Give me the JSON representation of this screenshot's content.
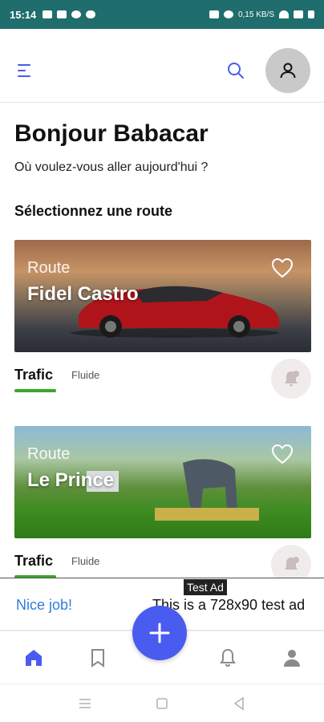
{
  "status_bar": {
    "time": "15:14",
    "right_text": "0,15 KB/S",
    "background": "#1f6d6d"
  },
  "app_bar": {
    "menu_icon": "menu-icon",
    "search_icon": "search-icon",
    "avatar_icon": "user-icon"
  },
  "greeting": {
    "title": "Bonjour Babacar",
    "subtitle": "Où voulez-vous aller aujourd'hui ?"
  },
  "section": {
    "title": "Sélectionnez une route"
  },
  "routes": [
    {
      "label": "Route",
      "name": "Fidel Castro",
      "traffic_label": "Trafic",
      "traffic_status": "Fluide",
      "traffic_color": "#3ca52a"
    },
    {
      "label": "Route",
      "name": "Le Prince",
      "traffic_label": "Trafic",
      "traffic_status": "Fluide",
      "traffic_color": "#3ca52a"
    }
  ],
  "ad": {
    "badge": "Test Ad",
    "nice": "Nice job!",
    "text": "This is a 728x90 test ad"
  },
  "bottom_nav": {
    "items": [
      "home-icon",
      "bookmark-icon",
      "bell-icon",
      "profile-icon"
    ],
    "fab_icon": "plus-icon",
    "accent": "#4a5bf0"
  }
}
